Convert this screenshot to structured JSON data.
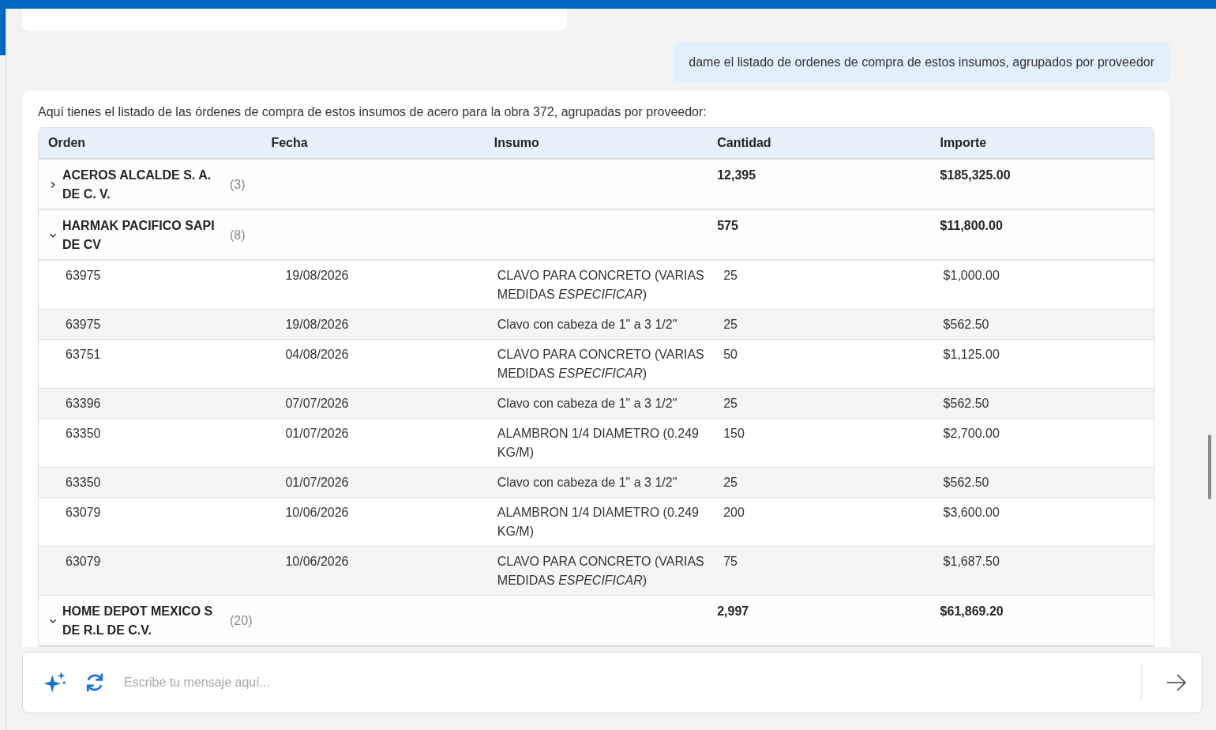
{
  "user_message": "dame el listado de ordenes de compra de estos insumos, agrupados por proveedor",
  "assistant_intro": "Aquí tienes el listado de las órdenes de compra de estos insumos de acero para la obra 372, agrupadas por proveedor:",
  "table": {
    "columns": [
      "Orden",
      "Fecha",
      "Insumo",
      "Cantidad",
      "Importe"
    ],
    "groups": [
      {
        "name": "ACEROS ALCALDE S. A. DE C. V.",
        "count": "(3)",
        "cantidad": "12,395",
        "importe": "$185,325.00",
        "expanded": false
      },
      {
        "name": "HARMAK PACIFICO SAPI DE CV",
        "count": "(8)",
        "cantidad": "575",
        "importe": "$11,800.00",
        "expanded": true,
        "rows": [
          {
            "orden": "63975",
            "fecha": "19/08/2026",
            "insumo": "CLAVO PARA CONCRETO (VARIAS MEDIDAS *ESPECIFICAR*)",
            "cantidad": "25",
            "importe": "$1,000.00"
          },
          {
            "orden": "63975",
            "fecha": "19/08/2026",
            "insumo": "Clavo con cabeza de 1\" a 3 1/2\"",
            "cantidad": "25",
            "importe": "$562.50"
          },
          {
            "orden": "63751",
            "fecha": "04/08/2026",
            "insumo": "CLAVO PARA CONCRETO (VARIAS MEDIDAS *ESPECIFICAR*)",
            "cantidad": "50",
            "importe": "$1,125.00"
          },
          {
            "orden": "63396",
            "fecha": "07/07/2026",
            "insumo": "Clavo con cabeza de 1\" a 3 1/2\"",
            "cantidad": "25",
            "importe": "$562.50"
          },
          {
            "orden": "63350",
            "fecha": "01/07/2026",
            "insumo": "ALAMBRON 1/4 DIAMETRO (0.249 KG/M)",
            "cantidad": "150",
            "importe": "$2,700.00"
          },
          {
            "orden": "63350",
            "fecha": "01/07/2026",
            "insumo": "Clavo con cabeza de 1\" a 3 1/2\"",
            "cantidad": "25",
            "importe": "$562.50"
          },
          {
            "orden": "63079",
            "fecha": "10/06/2026",
            "insumo": "ALAMBRON 1/4 DIAMETRO (0.249 KG/M)",
            "cantidad": "200",
            "importe": "$3,600.00"
          },
          {
            "orden": "63079",
            "fecha": "10/06/2026",
            "insumo": "CLAVO PARA CONCRETO (VARIAS MEDIDAS *ESPECIFICAR*)",
            "cantidad": "75",
            "importe": "$1,687.50"
          }
        ]
      },
      {
        "name": "HOME DEPOT MEXICO S DE R.L DE C.V.",
        "count": "(20)",
        "cantidad": "2,997",
        "importe": "$61,869.20",
        "expanded": true
      }
    ]
  },
  "composer": {
    "placeholder": "Escribe tu mensaje aquí..."
  }
}
